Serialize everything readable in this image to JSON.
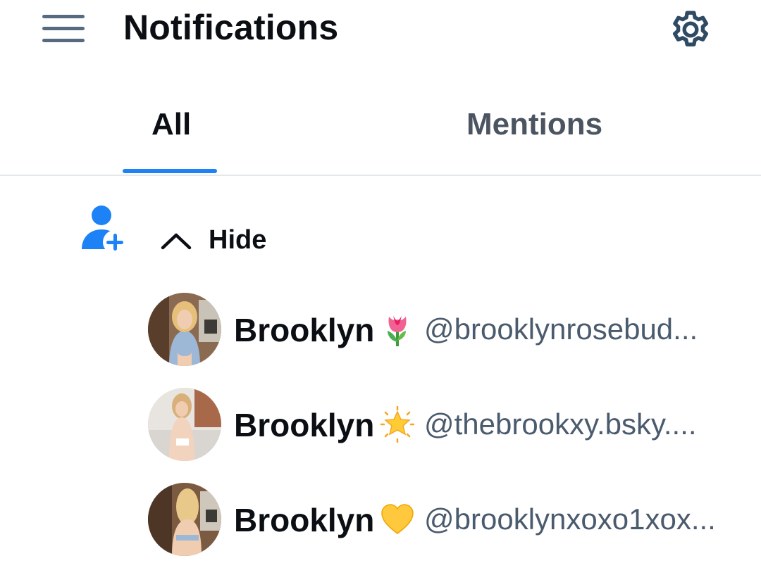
{
  "header": {
    "title": "Notifications",
    "menu_icon": "hamburger-menu-icon",
    "settings_icon": "gear-icon"
  },
  "tabs": [
    {
      "label": "All",
      "active": true
    },
    {
      "label": "Mentions",
      "active": false
    }
  ],
  "colors": {
    "accent": "#1d82f5",
    "text_primary": "#0b0f14",
    "text_secondary": "#4b5b6e",
    "icon_muted": "#576b80"
  },
  "follow_group": {
    "icon": "person-add-icon",
    "toggle_icon": "chevron-up-icon",
    "toggle_label": "Hide"
  },
  "users": [
    {
      "name": "Brooklyn",
      "emoji": "🌷",
      "emoji_icon": "tulip-icon",
      "handle": "@brooklynrosebud..."
    },
    {
      "name": "Brooklyn",
      "emoji": "🌟",
      "emoji_icon": "glowing-star-icon",
      "handle": "@thebrookxy.bsky...."
    },
    {
      "name": "Brooklyn",
      "emoji": "💛",
      "emoji_icon": "yellow-heart-icon",
      "handle": "@brooklynxoxo1xox..."
    }
  ]
}
